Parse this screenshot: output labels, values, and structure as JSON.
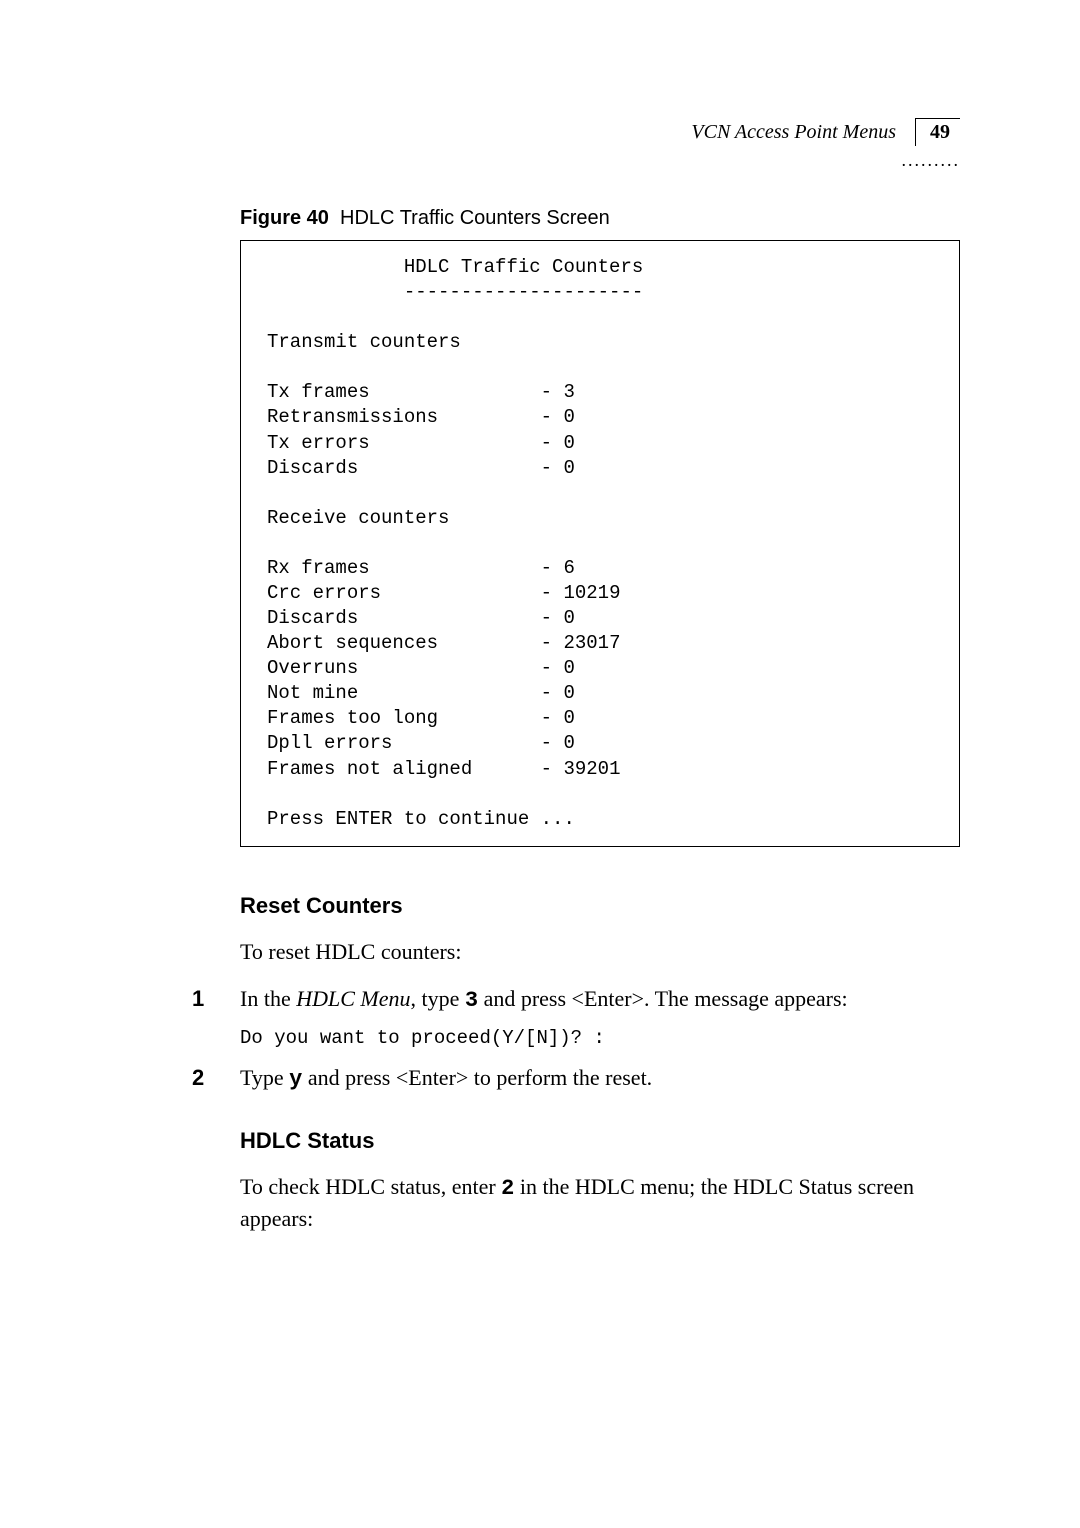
{
  "header": {
    "section_title": "VCN Access Point Menus",
    "page_number": "49",
    "dots": "........."
  },
  "figure": {
    "label": "Figure 40",
    "caption": "HDLC Traffic Counters Screen"
  },
  "codebox": {
    "title": "HDLC Traffic Counters",
    "rule": "---------------------",
    "tx_header": "Transmit counters",
    "tx": {
      "frames_label": "Tx frames",
      "frames_val": " - 3",
      "retrans_label": "Retransmissions",
      "retrans_val": " - 0",
      "errors_label": "Tx errors",
      "errors_val": " - 0",
      "discards_label": "Discards",
      "discards_val": " - 0"
    },
    "rx_header": "Receive counters",
    "rx": {
      "frames_label": "Rx frames",
      "frames_val": " - 6",
      "crc_label": "Crc errors",
      "crc_val": " - 10219",
      "discards_label": "Discards",
      "discards_val": " - 0",
      "abort_label": "Abort sequences",
      "abort_val": " - 23017",
      "overruns_label": "Overruns",
      "overruns_val": " - 0",
      "notmine_label": "Not mine",
      "notmine_val": " - 0",
      "toolong_label": "Frames too long",
      "toolong_val": " - 0",
      "dpll_label": "Dpll errors",
      "dpll_val": " - 0",
      "align_label": "Frames not aligned",
      "align_val": " - 39201"
    },
    "prompt": "Press ENTER to continue ..."
  },
  "reset": {
    "heading": "Reset Counters",
    "intro": "To reset HDLC counters:",
    "step1_num": "1",
    "step1_a": "In the ",
    "step1_menu": "HDLC Menu",
    "step1_b": ", type ",
    "step1_key": "3",
    "step1_c": "  and press <Enter>. The message appears:",
    "code": "Do you want to proceed(Y/[N])? :",
    "step2_num": "2",
    "step2_a": "Type ",
    "step2_key": "y",
    "step2_b": " and press <Enter> to perform the reset."
  },
  "status": {
    "heading": "HDLC Status",
    "body_a": "To check HDLC status, enter ",
    "body_key": "2",
    "body_b": " in the HDLC menu; the HDLC Status screen appears:"
  }
}
